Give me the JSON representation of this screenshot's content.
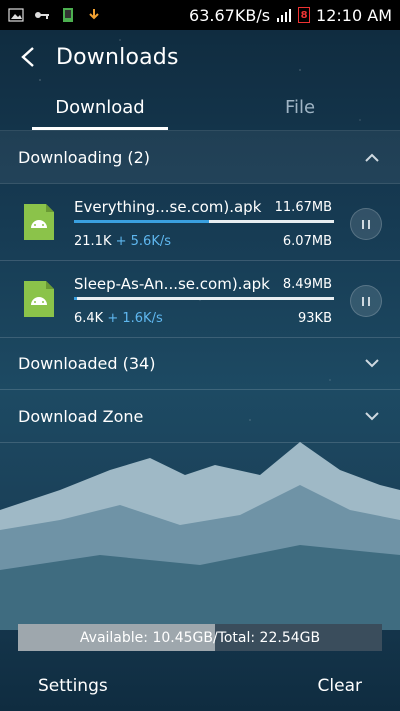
{
  "status_bar": {
    "speed": "63.67KB/s",
    "battery": "8",
    "time": "12:10 AM",
    "icons": [
      "image-icon",
      "key-icon",
      "sd-card-icon",
      "download-arrow-icon",
      "signal-icon",
      "battery-icon"
    ]
  },
  "app_bar": {
    "title": "Downloads",
    "back_icon": "back-arrow-icon"
  },
  "tabs": [
    {
      "label": "Download"
    },
    {
      "label": "File"
    }
  ],
  "downloading": {
    "header": "Downloading (2)",
    "items": [
      {
        "name": "Everything...se.com).apk",
        "total": "11.67MB",
        "downloaded": "21.1K",
        "rate": "+ 5.6K/s",
        "done": "6.07MB",
        "progress": 0.52
      },
      {
        "name": "Sleep-As-An...se.com).apk",
        "total": "8.49MB",
        "downloaded": "6.4K",
        "rate": "+ 1.6K/s",
        "done": "93KB",
        "progress": 0.01
      }
    ]
  },
  "downloaded": {
    "header": "Downloaded (34)"
  },
  "download_zone": {
    "header": "Download Zone"
  },
  "storage": {
    "text": "Available: 10.45GB/Total: 22.54GB",
    "used_fraction": 0.54
  },
  "bottom_bar": {
    "settings": "Settings",
    "clear": "Clear"
  },
  "colors": {
    "accent": "#3aa0e0",
    "rate": "#5fb7ef",
    "android_green": "#8bc34a"
  }
}
